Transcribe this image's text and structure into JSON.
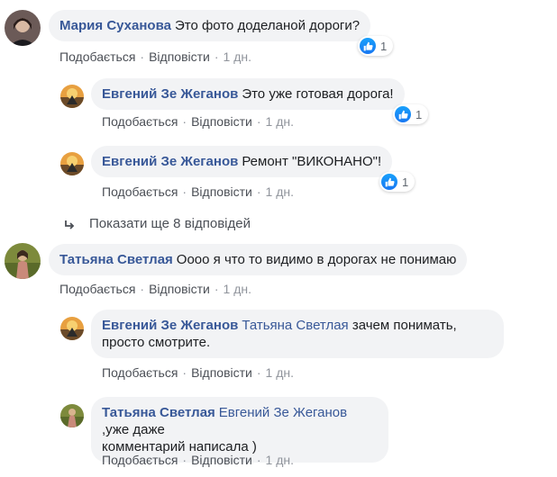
{
  "comments": [
    {
      "author": "Мария Суханова",
      "text": "Это фото доделаной дороги?",
      "like": "Подобається",
      "reply": "Відповісти",
      "time": "1 дн.",
      "reaction_count": "1"
    },
    {
      "author": "Евгений Зе Жеганов",
      "text": "Это уже готовая дорога!",
      "like": "Подобається",
      "reply": "Відповісти",
      "time": "1 дн.",
      "reaction_count": "1"
    },
    {
      "author": "Евгений Зе Жеганов",
      "text": "Ремонт \"ВИКОНАНО\"!",
      "like": "Подобається",
      "reply": "Відповісти",
      "time": "1 дн.",
      "reaction_count": "1"
    },
    {
      "author": "Татьяна Светлая",
      "text": "Оооо я что то видимо в дорогах не понимаю",
      "like": "Подобається",
      "reply": "Відповісти",
      "time": "1 дн."
    },
    {
      "author": "Евгений Зе Жеганов",
      "mention": "Татьяна Светлая",
      "text_line1": "зачем понимать,",
      "text_line2": "просто смотрите.",
      "like": "Подобається",
      "reply": "Відповісти",
      "time": "1 дн."
    },
    {
      "author": "Татьяна Светлая",
      "mention": "Евгений Зе Жеганов",
      "text_line1": ",уже даже",
      "text_line2": "комментарий написала )",
      "like": "Подобається",
      "reply": "Відповісти",
      "time": "1 дн."
    }
  ],
  "more_replies": "Показати ще 8 відповідей",
  "separator": "·",
  "colors": {
    "author": "#385898",
    "bubble": "#f2f3f5",
    "like_blue": "#1877f2",
    "meta": "#90949c"
  }
}
